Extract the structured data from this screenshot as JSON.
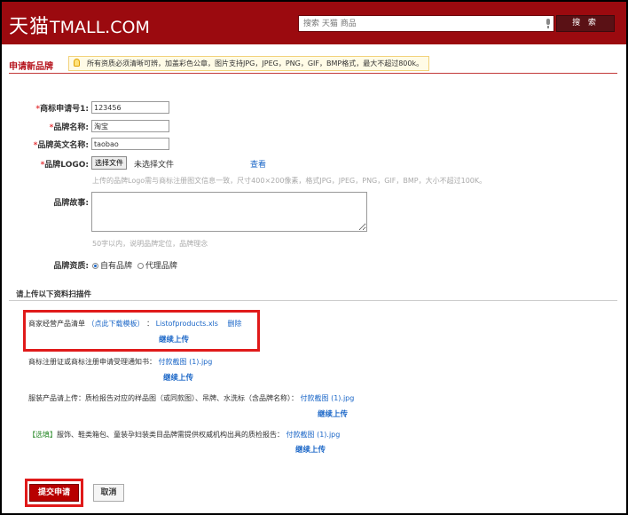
{
  "header": {
    "logo_cn": "天猫",
    "logo_domain": "TMALL.COM",
    "search_placeholder": "搜索 天猫 商品",
    "search_button": "搜 索"
  },
  "page": {
    "title": "申请新品牌",
    "notice": "所有资质必须清晰可辨，加盖彩色公章，图片支持JPG，JPEG，PNG，GIF，BMP格式，最大不超过800k。"
  },
  "form": {
    "trademark_no": {
      "label": "商标申请号1:",
      "value": "123456"
    },
    "brand_name": {
      "label": "品牌名称:",
      "value": "淘宝"
    },
    "brand_en_name": {
      "label": "品牌英文名称:",
      "value": "taobao"
    },
    "brand_logo": {
      "label": "品牌LOGO:",
      "choose_file": "选择文件",
      "no_file": "未选择文件",
      "view_link": "查看",
      "hint": "上传的品牌Logo需与商标注册图文信息一致，尺寸400×200像素，格式JPG，JPEG，PNG，GIF，BMP，大小不超过100K。"
    },
    "brand_story": {
      "label": "品牌故事:",
      "hint": "50字以内，说明品牌定位，品牌理念"
    },
    "brand_qualification": {
      "label": "品牌资质:",
      "options": [
        "自有品牌",
        "代理品牌"
      ],
      "selected": "自有品牌"
    }
  },
  "uploads": {
    "section_title": "请上传以下资料扫描件",
    "continue_label": "继续上传",
    "items": [
      {
        "label": "商家经营产品清单",
        "template_link": "（点此下载模板）",
        "separator": "：",
        "file": "Listofproducts.xls",
        "delete": "删除"
      },
      {
        "label": "商标注册证或商标注册申请受理通知书：",
        "file": "付款截图 (1).jpg"
      },
      {
        "label": "服装产品请上传：质检报告对应的样品图（或同款图）、吊牌、水洗标（含品牌名称）：",
        "file": "付款截图 (1).jpg"
      },
      {
        "tag": "【选填】",
        "label": "服饰、鞋类箱包、童装孕妇装类目品牌需提供权威机构出具的质检报告：",
        "file": "付款截图 (1).jpg"
      }
    ]
  },
  "actions": {
    "submit": "提交申请",
    "cancel": "取消"
  },
  "colors": {
    "brand_red": "#9b0a0f",
    "link_blue": "#1a66c7",
    "highlight_red": "#e01a1a"
  }
}
